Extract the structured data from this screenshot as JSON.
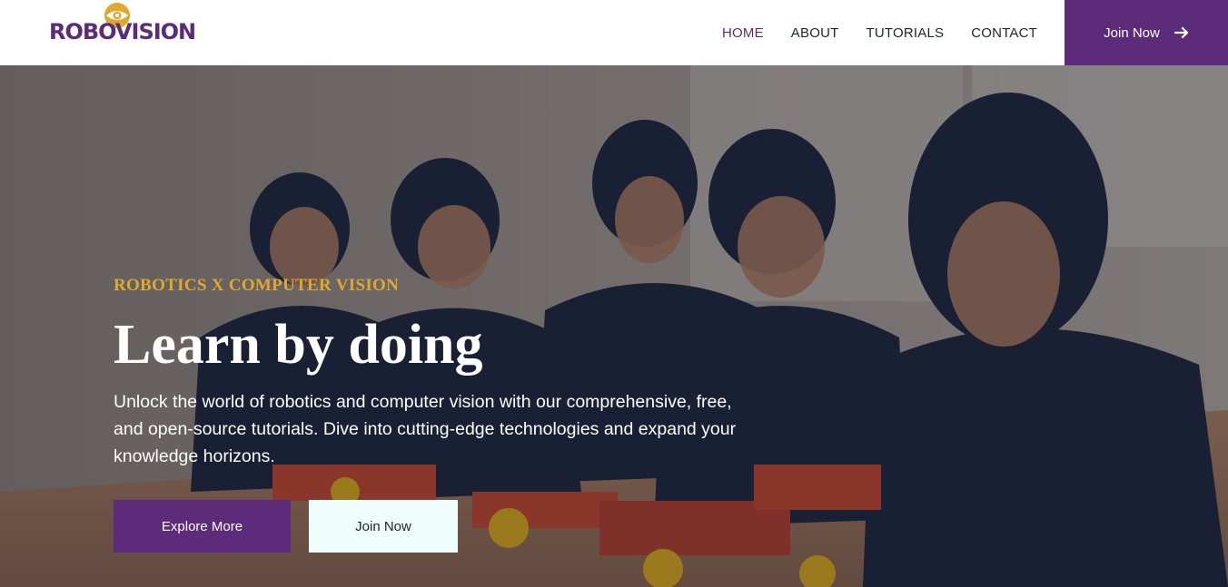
{
  "brand": {
    "logo_text": "ROBOVISION",
    "primary_color": "#5c2b7a",
    "accent_color": "#e0a82e",
    "eye_icon": "eye-icon"
  },
  "nav": {
    "items": [
      {
        "label": "HOME",
        "active": true
      },
      {
        "label": "ABOUT",
        "active": false
      },
      {
        "label": "TUTORIALS",
        "active": false
      },
      {
        "label": "CONTACT",
        "active": false
      }
    ],
    "cta_label": "Join Now",
    "cta_icon": "arrow-right-icon"
  },
  "hero": {
    "eyebrow": "ROBOTICS X COMPUTER VISION",
    "title": "Learn by doing",
    "description": "Unlock the world of robotics and computer vision with our comprehensive, free, and open-source tutorials. Dive into cutting-edge technologies and expand your knowledge horizons.",
    "primary_button": "Explore More",
    "secondary_button": "Join Now",
    "background_image": "students-building-robots-photo"
  }
}
